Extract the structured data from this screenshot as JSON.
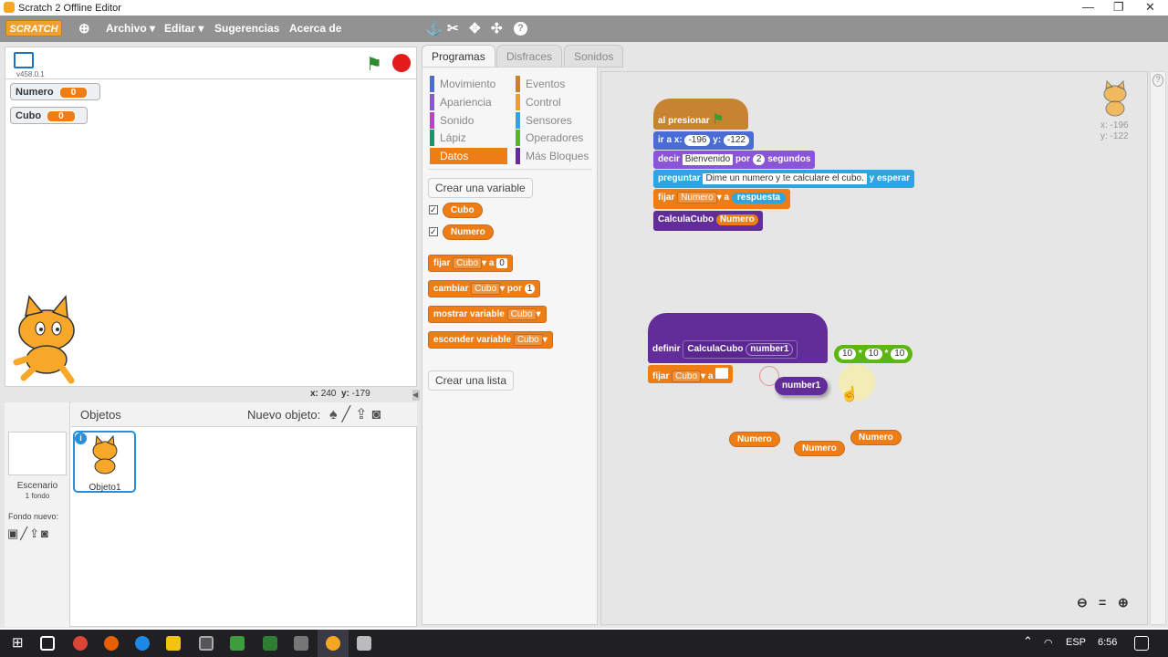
{
  "window": {
    "title": "Scratch 2 Offline Editor",
    "controls": [
      "—",
      "❐",
      "✕"
    ]
  },
  "menubar": {
    "logo": "SCRATCH",
    "items": [
      "Archivo ▾",
      "Editar ▾",
      "Sugerencias",
      "Acerca de"
    ],
    "tool_icons": [
      "duplicate-icon",
      "delete-icon",
      "grow-icon",
      "shrink-icon",
      "help-icon"
    ]
  },
  "stage": {
    "version": "v458.0.1",
    "monitors": [
      {
        "label": "Numero",
        "value": "0"
      },
      {
        "label": "Cubo",
        "value": "0"
      }
    ],
    "coords": {
      "x_label": "x:",
      "x": "240",
      "y_label": "y:",
      "y": "-179"
    }
  },
  "sprites": {
    "header": "Objetos",
    "new_sprite_label": "Nuevo objeto:",
    "stage_label": "Escenario",
    "stage_sub": "1 fondo",
    "new_backdrop_label": "Fondo nuevo:",
    "sprite_name": "Objeto1"
  },
  "tabs": [
    "Programas",
    "Disfraces",
    "Sonidos"
  ],
  "categories": {
    "left": [
      {
        "label": "Movimiento",
        "color": "#4a6cd4"
      },
      {
        "label": "Apariencia",
        "color": "#8a55d7"
      },
      {
        "label": "Sonido",
        "color": "#bb42c3"
      },
      {
        "label": "Lápiz",
        "color": "#0e9a6c"
      },
      {
        "label": "Datos",
        "color": "#ee7d16"
      }
    ],
    "right": [
      {
        "label": "Eventos",
        "color": "#c88330"
      },
      {
        "label": "Control",
        "color": "#e1a91a"
      },
      {
        "label": "Sensores",
        "color": "#2ca5e2"
      },
      {
        "label": "Operadores",
        "color": "#5cb712"
      },
      {
        "label": "Más Bloques",
        "color": "#632d99"
      }
    ]
  },
  "palette": {
    "make_variable": "Crear una variable",
    "variables": [
      "Cubo",
      "Numero"
    ],
    "set_block": {
      "word": "fijar",
      "var": "Cubo",
      "to": "a",
      "value": "0"
    },
    "change_block": {
      "word": "cambiar",
      "var": "Cubo",
      "by": "por",
      "value": "1"
    },
    "show_block": {
      "word": "mostrar variable",
      "var": "Cubo"
    },
    "hide_block": {
      "word": "esconder variable",
      "var": "Cubo"
    },
    "make_list": "Crear una lista"
  },
  "script": {
    "hat": "al presionar",
    "goto": {
      "word": "ir a x:",
      "x": "-196",
      "y_label": "y:",
      "y": "-122"
    },
    "say": {
      "word": "decir",
      "text": "Bienvenido",
      "for": "por",
      "secs": "2",
      "unit": "segundos"
    },
    "ask": {
      "word": "preguntar",
      "text": "Dime un numero y te calculare el cubo.",
      "wait": "y esperar"
    },
    "set": {
      "word": "fijar",
      "var": "Numero",
      "to": "a",
      "value": "respuesta"
    },
    "call": {
      "word": "CalculaCubo",
      "arg": "Numero"
    },
    "define": {
      "word": "definir",
      "name": "CalculaCubo",
      "param": "number1"
    },
    "def_set": {
      "word": "fijar",
      "var": "Cubo",
      "to": "a"
    },
    "operator": {
      "a": "10",
      "op1": "*",
      "b": "10",
      "op2": "*",
      "c": "10"
    },
    "loose_param": "number1",
    "loose_vars": [
      "Numero",
      "Numero",
      "Numero"
    ],
    "sprite_coords": {
      "x": "x: -196",
      "y": "y: -122"
    }
  },
  "zoom_controls": [
    "zoom-out-icon",
    "zoom-reset-icon",
    "zoom-in-icon"
  ],
  "taskbar": {
    "lang": "ESP",
    "time": "6:56"
  }
}
